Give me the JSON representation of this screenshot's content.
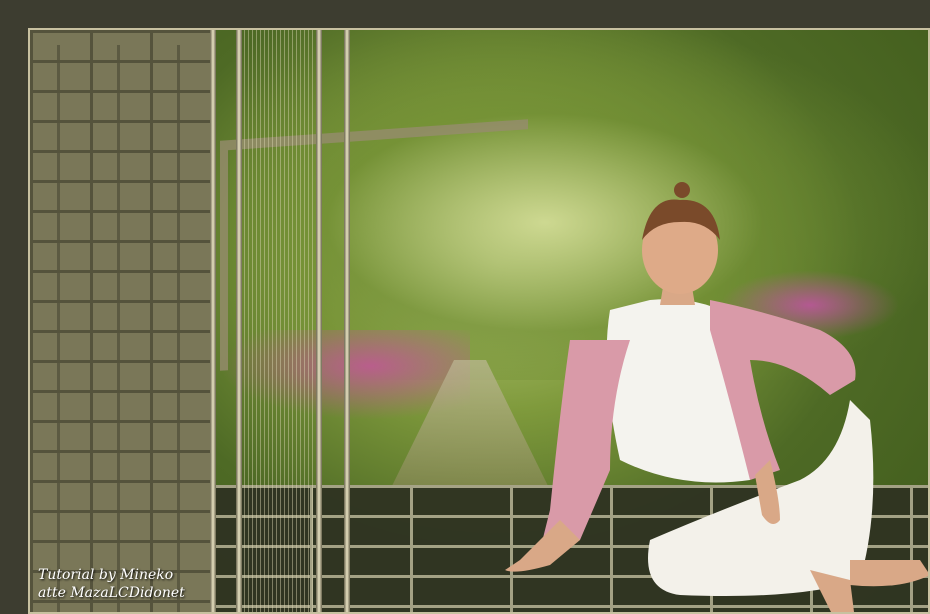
{
  "credit": {
    "line1": "Tutorial by Mineko",
    "line2": "atte MazaLCDidonet"
  },
  "colors": {
    "frame": "#3d3d30",
    "border_light": "#c8c1a0",
    "foliage": "#7f9a3c",
    "blossom": "#c850a0",
    "brick": "#7a7758"
  },
  "scene": {
    "subject": "woman in pink jacket and white outfit seated on grid floor",
    "background": "tree-lined path with pink blossoms"
  }
}
